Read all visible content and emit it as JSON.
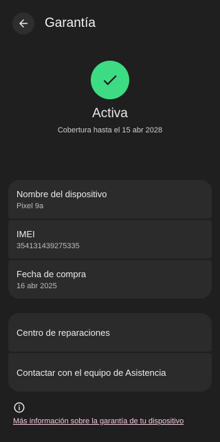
{
  "header": {
    "title": "Garantía"
  },
  "status": {
    "label": "Activa",
    "coverage": "Cobertura hasta el 15 abr 2028",
    "color": "#3ddc84"
  },
  "device_info": [
    {
      "label": "Nombre del dispositivo",
      "value": "Pixel 9a"
    },
    {
      "label": "IMEI",
      "value": "354131439275335"
    },
    {
      "label": "Fecha de compra",
      "value": "16 abr 2025"
    }
  ],
  "actions": [
    {
      "label": "Centro de reparaciones"
    },
    {
      "label": "Contactar con el equipo de Asistencia"
    }
  ],
  "footer": {
    "info_icon": "info-icon",
    "link_text": "Más información sobre la garantía de tu dispositivo",
    "link_color": "#f2c8dc"
  }
}
